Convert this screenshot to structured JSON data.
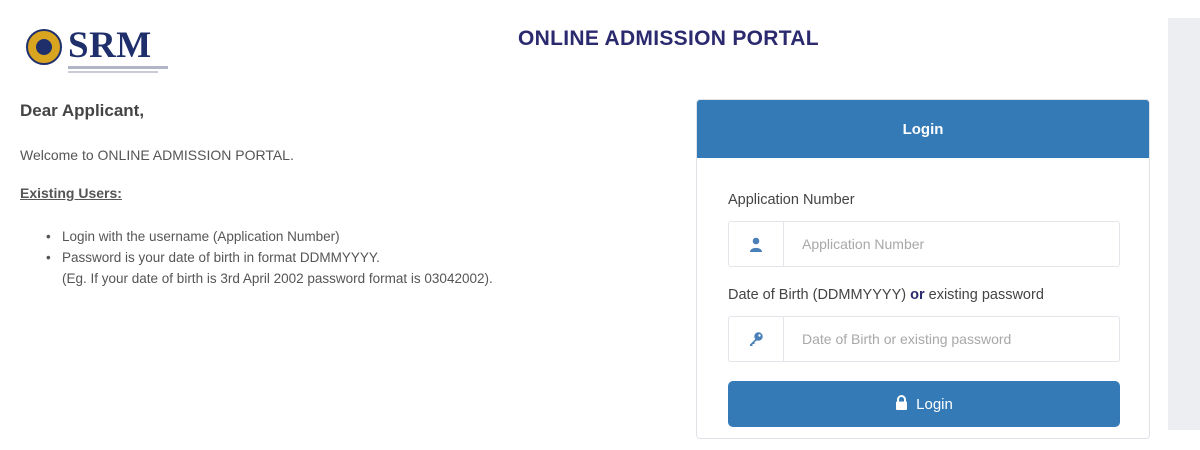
{
  "header": {
    "logo_text": "SRM",
    "title": "ONLINE ADMISSION PORTAL"
  },
  "intro": {
    "greeting": "Dear Applicant,",
    "welcome": "Welcome to ONLINE ADMISSION PORTAL.",
    "existing_users_heading": "Existing Users:",
    "bullets": [
      "Login with the username (Application Number)",
      "Password is your date of birth in format DDMMYYYY."
    ],
    "example": "(Eg. If your date of birth is 3rd April 2002 password format is 03042002)."
  },
  "login_panel": {
    "heading": "Login",
    "application_label": "Application Number",
    "application_placeholder": "Application Number",
    "dob_label_part1": "Date of Birth (DDMMYYYY)",
    "dob_label_or": "or",
    "dob_label_part2": "existing password",
    "dob_placeholder": "Date of Birth or existing password",
    "button_label": "Login",
    "icons": {
      "user": "user-icon",
      "key": "key-icon",
      "lock": "lock-icon"
    },
    "accent_color": "#337ab7"
  }
}
